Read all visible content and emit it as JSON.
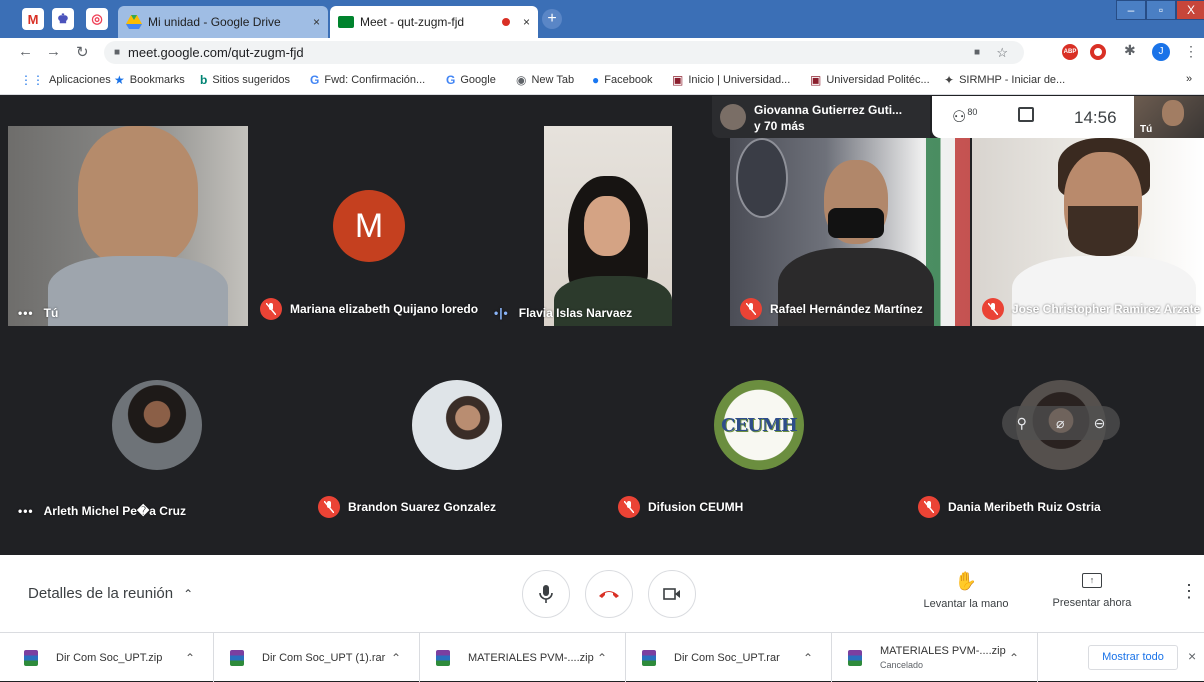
{
  "browser": {
    "pinned_tabs": [
      {
        "icon": "gmail-icon",
        "label": "M"
      },
      {
        "icon": "ms-teams-icon",
        "label": "♚"
      },
      {
        "icon": "pocket-icon",
        "label": "◎"
      }
    ],
    "tabs": [
      {
        "title": "Mi unidad - Google Drive",
        "close": "×"
      },
      {
        "title": "Meet - qut-zugm-fjd",
        "close": "×"
      }
    ],
    "url": "meet.google.com/qut-zugm-fjd",
    "window_controls": {
      "minimize": "–",
      "maximize": "▫",
      "close": "X"
    }
  },
  "bookmarks": [
    {
      "label": "Aplicaciones",
      "icon": "apps-icon"
    },
    {
      "label": "Bookmarks",
      "icon": "star-icon"
    },
    {
      "label": "Sitios sugeridos",
      "icon": "bing-icon"
    },
    {
      "label": "Fwd: Confirmación...",
      "icon": "google-icon"
    },
    {
      "label": "Google",
      "icon": "google-icon"
    },
    {
      "label": "New Tab",
      "icon": "globe-icon"
    },
    {
      "label": "Facebook",
      "icon": "facebook-icon"
    },
    {
      "label": "Inicio | Universidad...",
      "icon": "university-icon"
    },
    {
      "label": "Universidad Politéc...",
      "icon": "university-icon"
    },
    {
      "label": "SIRMHP - Iniciar de...",
      "icon": "sirmhp-icon"
    }
  ],
  "bookmarks_more": "»",
  "meet": {
    "presenter": {
      "name": "Giovanna Gutierrez Guti...",
      "others": "y 70 más"
    },
    "participants_count": "80",
    "time": "14:56",
    "self_label": "Tú",
    "tiles_row1": [
      {
        "name": "Tú",
        "state": "dots"
      },
      {
        "name": "Mariana elizabeth Quijano loredo",
        "state": "muted",
        "initial": "M"
      },
      {
        "name": "Flavia Islas Narvaez",
        "state": "speaking"
      },
      {
        "name": "Rafael Hernández Martínez",
        "state": "muted"
      },
      {
        "name": "Jose Christopher Ramirez Arzate",
        "state": "muted"
      }
    ],
    "tiles_row2": [
      {
        "name": "Arleth Michel Pe�a Cruz",
        "state": "dots"
      },
      {
        "name": "Brandon Suarez Gonzalez",
        "state": "muted"
      },
      {
        "name": "Difusion CEUMH",
        "state": "muted",
        "logo_text": "CEUMH"
      },
      {
        "name": "Dania Meribeth Ruiz Ostria",
        "state": "muted"
      }
    ]
  },
  "bottom": {
    "meeting_details": "Detalles de la reunión",
    "raise_hand": "Levantar la mano",
    "present_now": "Presentar ahora"
  },
  "downloads": [
    {
      "name": "Dir Com Soc_UPT.zip",
      "status": ""
    },
    {
      "name": "Dir Com Soc_UPT (1).rar",
      "status": ""
    },
    {
      "name": "MATERIALES PVM-....zip",
      "status": ""
    },
    {
      "name": "Dir Com Soc_UPT.rar",
      "status": ""
    },
    {
      "name": "MATERIALES PVM-....zip",
      "status": "Cancelado"
    }
  ],
  "show_all": "Mostrar todo"
}
